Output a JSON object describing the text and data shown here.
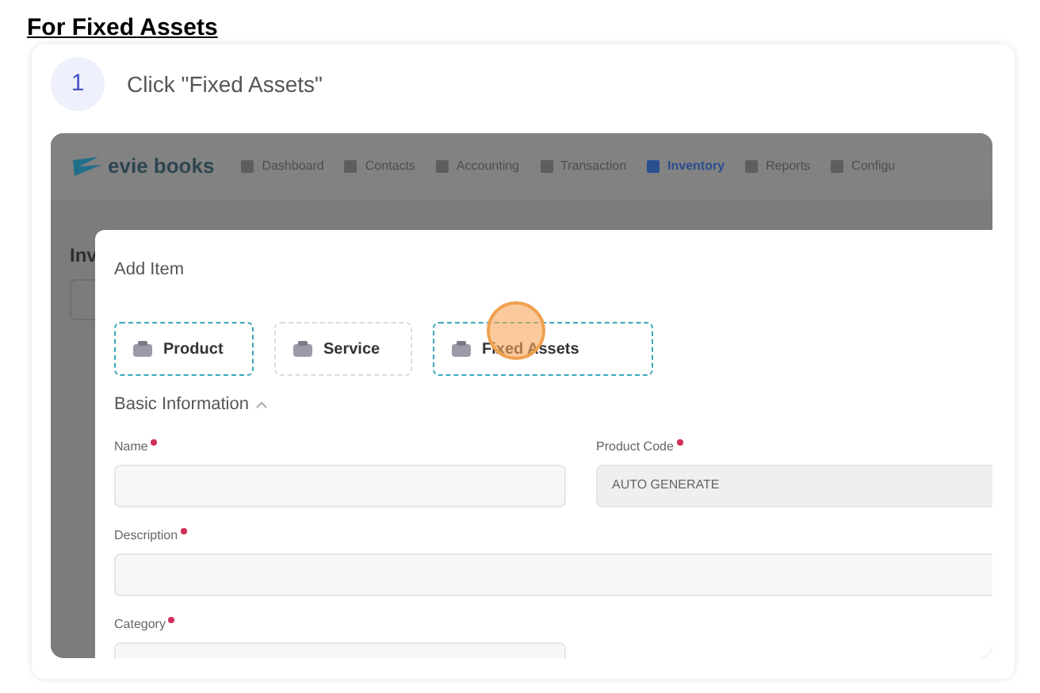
{
  "heading": "For Fixed Assets",
  "step": {
    "number": "1",
    "instruction": "Click \"Fixed Assets\""
  },
  "app": {
    "logo": "evie books",
    "nav": [
      {
        "label": "Dashboard",
        "selected": false
      },
      {
        "label": "Contacts",
        "selected": false
      },
      {
        "label": "Accounting",
        "selected": false
      },
      {
        "label": "Transaction",
        "selected": false
      },
      {
        "label": "Inventory",
        "selected": true
      },
      {
        "label": "Reports",
        "selected": false
      },
      {
        "label": "Configu",
        "selected": false
      }
    ],
    "page_title": "Inv",
    "modal": {
      "title": "Add Item",
      "item_types": [
        {
          "label": "Product",
          "selected": true,
          "clicked": false
        },
        {
          "label": "Service",
          "selected": false,
          "clicked": false
        },
        {
          "label": "Fixed Assets",
          "selected": true,
          "clicked": true
        }
      ],
      "section": "Basic Information",
      "fields": [
        {
          "label": "Name",
          "required": true
        },
        {
          "label": "Product Code",
          "required": true,
          "value": "AUTO GENERATE"
        },
        {
          "label": "Description",
          "required": true
        },
        {
          "label": "Category",
          "required": true
        }
      ]
    }
  }
}
